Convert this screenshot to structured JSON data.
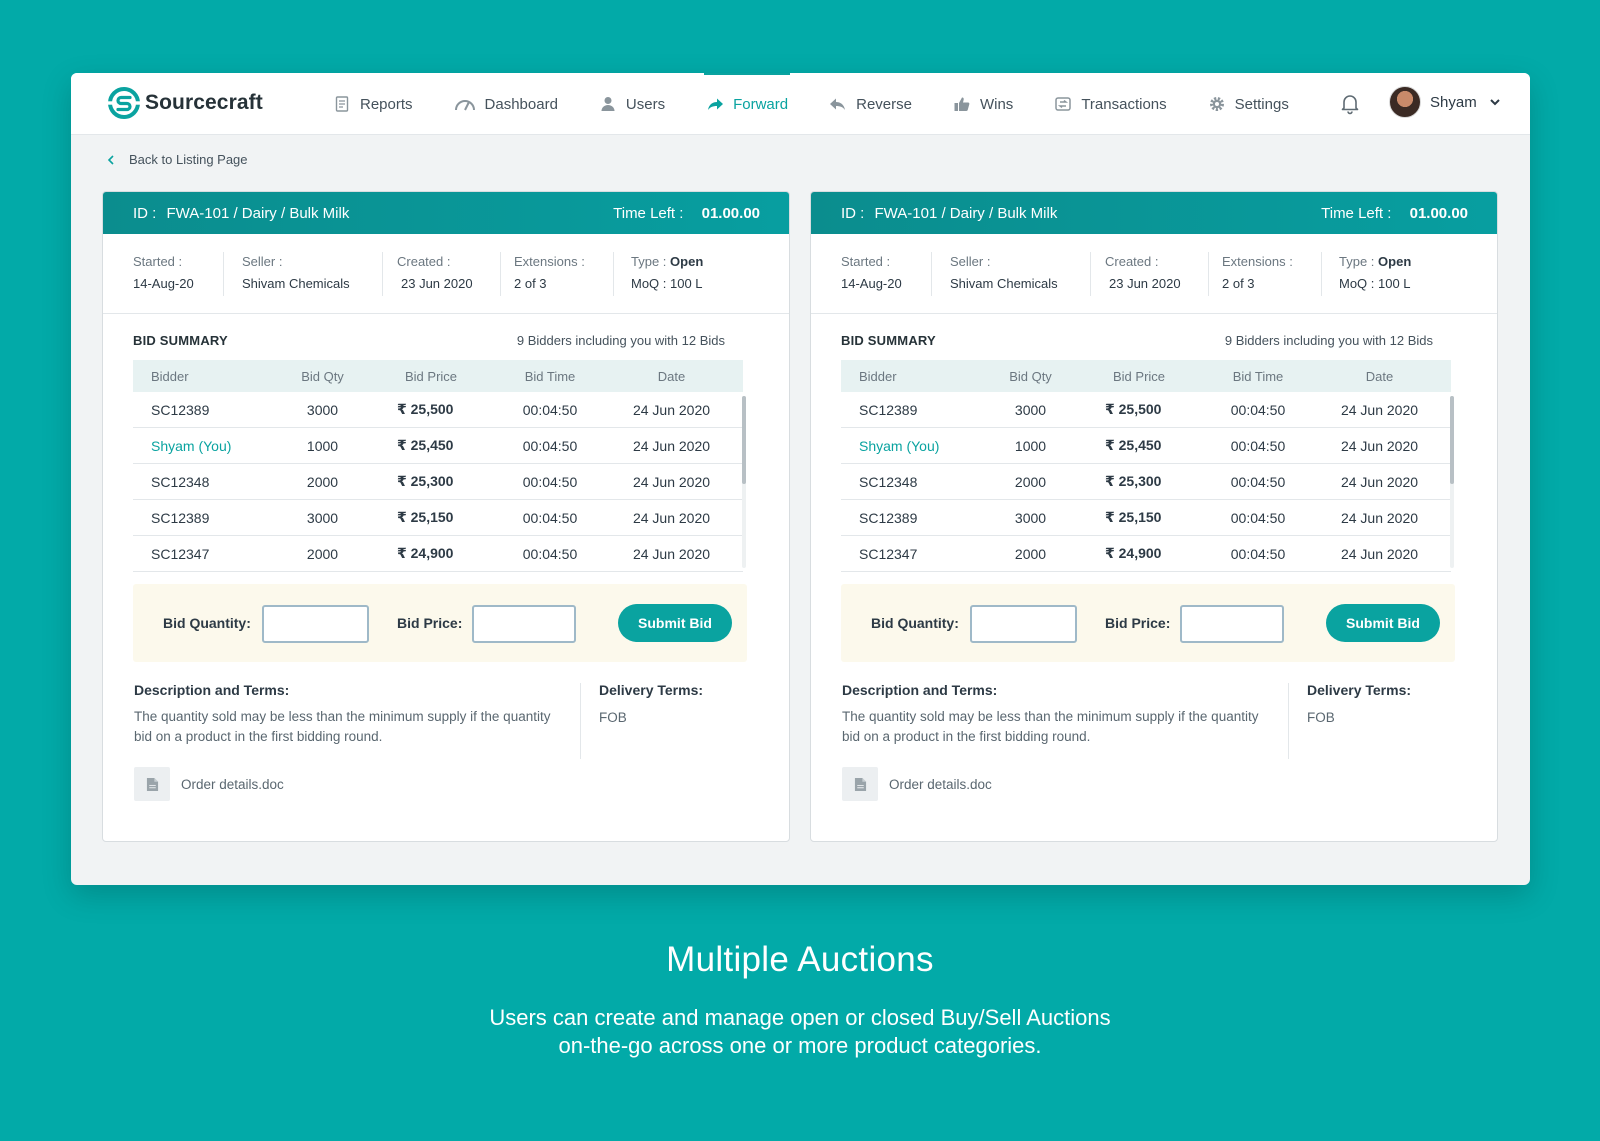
{
  "app": {
    "brand": "Sourcecraft",
    "nav": [
      {
        "label": "Reports",
        "icon": "document-icon"
      },
      {
        "label": "Dashboard",
        "icon": "gauge-icon"
      },
      {
        "label": "Users",
        "icon": "user-icon"
      },
      {
        "label": "Forward",
        "icon": "forward-arrow-icon",
        "active": true
      },
      {
        "label": "Reverse",
        "icon": "reverse-arrow-icon"
      },
      {
        "label": "Wins",
        "icon": "thumbs-up-icon"
      },
      {
        "label": "Transactions",
        "icon": "transactions-icon"
      },
      {
        "label": "Settings",
        "icon": "gear-icon"
      }
    ],
    "user_name": "Shyam",
    "back_label": "Back to Listing Page",
    "accent_color": "#0aa3a0"
  },
  "auctions": [
    {
      "id_label": "ID :",
      "id_value": "FWA-101 / Dairy / Bulk Milk",
      "time_left_label": "Time Left :",
      "time_left_value": "01.00.00",
      "started_label": "Started :",
      "started_value": "14-Aug-20",
      "seller_label": "Seller :",
      "seller_value": "Shivam Chemicals",
      "created_label": "Created :",
      "created_value": "23 Jun 2020",
      "extensions_label": "Extensions :",
      "extensions_value": "2 of 3",
      "type_label": "Type :",
      "type_value": "Open",
      "moq": "MoQ : 100 L",
      "bid_summary_title": "BID SUMMARY",
      "bid_summary_sub": "9 Bidders including you with 12 Bids",
      "columns": [
        "Bidder",
        "Bid Qty",
        "Bid Price",
        "Bid Time",
        "Date"
      ],
      "rows": [
        {
          "bidder": "SC12389",
          "qty": "3000",
          "price": "₹ 25,500",
          "time": "00:04:50",
          "date": "24 Jun 2020"
        },
        {
          "bidder": "Shyam (You)",
          "qty": "1000",
          "price": "₹ 25,450",
          "time": "00:04:50",
          "date": "24 Jun 2020",
          "you": true
        },
        {
          "bidder": "SC12348",
          "qty": "2000",
          "price": "₹ 25,300",
          "time": "00:04:50",
          "date": "24 Jun 2020"
        },
        {
          "bidder": "SC12389",
          "qty": "3000",
          "price": "₹  25,150",
          "time": "00:04:50",
          "date": "24 Jun 2020"
        },
        {
          "bidder": "SC12347",
          "qty": "2000",
          "price": "₹ 24,900",
          "time": "00:04:50",
          "date": "24 Jun 2020"
        }
      ],
      "bid_quantity_label": "Bid Quantity:",
      "bid_quantity_value": "",
      "bid_price_label": "Bid Price:",
      "bid_price_value": "",
      "submit_label": "Submit Bid",
      "desc_title": "Description and Terms:",
      "desc_text": "The quantity sold may be less than the minimum supply if the quantity bid on a product in the first bidding round.",
      "delivery_title": "Delivery Terms:",
      "delivery_value": "FOB",
      "attachment": "Order details.doc"
    },
    {
      "id_label": "ID :",
      "id_value": "FWA-101 / Dairy / Bulk Milk",
      "time_left_label": "Time Left :",
      "time_left_value": "01.00.00",
      "started_label": "Started :",
      "started_value": "14-Aug-20",
      "seller_label": "Seller :",
      "seller_value": "Shivam Chemicals",
      "created_label": "Created :",
      "created_value": "23 Jun 2020",
      "extensions_label": "Extensions :",
      "extensions_value": "2 of 3",
      "type_label": "Type :",
      "type_value": "Open",
      "moq": "MoQ : 100 L",
      "bid_summary_title": "BID SUMMARY",
      "bid_summary_sub": "9 Bidders including you with 12 Bids",
      "columns": [
        "Bidder",
        "Bid Qty",
        "Bid Price",
        "Bid Time",
        "Date"
      ],
      "rows": [
        {
          "bidder": "SC12389",
          "qty": "3000",
          "price": "₹ 25,500",
          "time": "00:04:50",
          "date": "24 Jun 2020"
        },
        {
          "bidder": "Shyam (You)",
          "qty": "1000",
          "price": "₹ 25,450",
          "time": "00:04:50",
          "date": "24 Jun 2020",
          "you": true
        },
        {
          "bidder": "SC12348",
          "qty": "2000",
          "price": "₹ 25,300",
          "time": "00:04:50",
          "date": "24 Jun 2020"
        },
        {
          "bidder": "SC12389",
          "qty": "3000",
          "price": "₹  25,150",
          "time": "00:04:50",
          "date": "24 Jun 2020"
        },
        {
          "bidder": "SC12347",
          "qty": "2000",
          "price": "₹ 24,900",
          "time": "00:04:50",
          "date": "24 Jun 2020"
        }
      ],
      "bid_quantity_label": "Bid Quantity:",
      "bid_quantity_value": "",
      "bid_price_label": "Bid Price:",
      "bid_price_value": "",
      "submit_label": "Submit Bid",
      "desc_title": "Description and Terms:",
      "desc_text": "The quantity sold may be less than the minimum supply if the quantity bid on a product in the first bidding round.",
      "delivery_title": "Delivery Terms:",
      "delivery_value": "FOB",
      "attachment": "Order details.doc"
    }
  ],
  "hero": {
    "title": "Multiple Auctions",
    "subtitle_line1": "Users can create and manage open or closed Buy/Sell Auctions",
    "subtitle_line2": "on-the-go across one or more product categories."
  }
}
